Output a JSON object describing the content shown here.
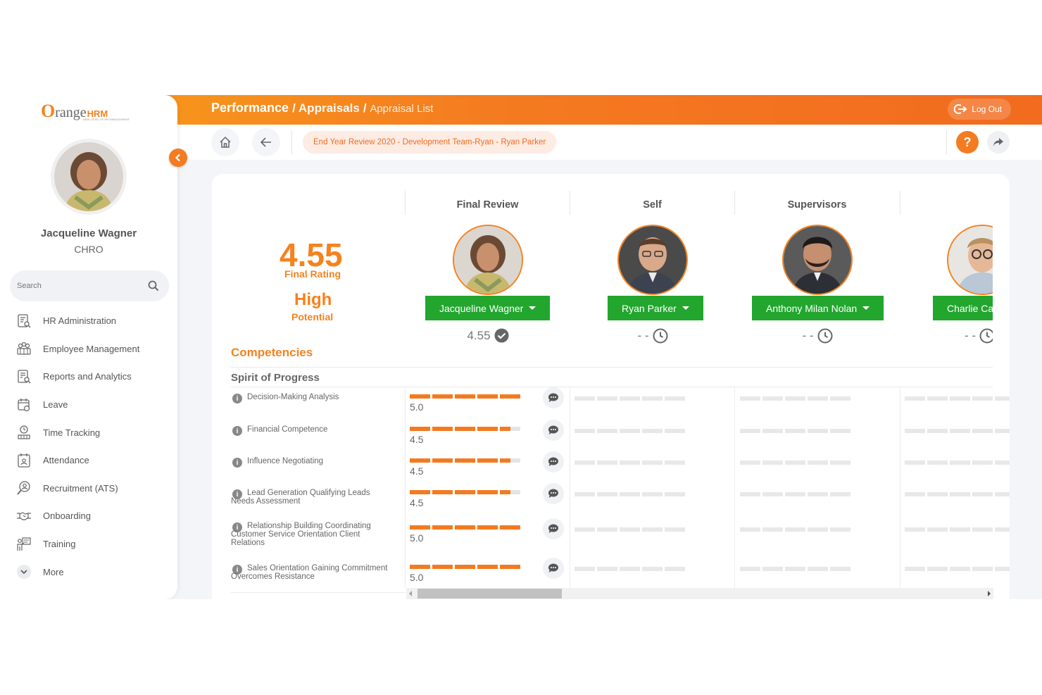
{
  "brand": {
    "logo_o": "O",
    "logo_range": "range",
    "logo_hrm": "HRM",
    "logo_tagline": "NEW LEVEL OF HR MANAGEMENT",
    "accent": "#f5821f",
    "green": "#22a62e"
  },
  "user": {
    "name": "Jacqueline Wagner",
    "role": "CHRO"
  },
  "search": {
    "placeholder": "Search"
  },
  "menu": [
    {
      "label": "HR Administration",
      "icon": "hr-admin-icon"
    },
    {
      "label": "Employee Management",
      "icon": "employee-management-icon"
    },
    {
      "label": "Reports and Analytics",
      "icon": "reports-icon"
    },
    {
      "label": "Leave",
      "icon": "leave-icon"
    },
    {
      "label": "Time Tracking",
      "icon": "time-tracking-icon"
    },
    {
      "label": "Attendance",
      "icon": "attendance-icon"
    },
    {
      "label": "Recruitment (ATS)",
      "icon": "recruitment-icon"
    },
    {
      "label": "Onboarding",
      "icon": "onboarding-icon"
    },
    {
      "label": "Training",
      "icon": "training-icon"
    },
    {
      "label": "More",
      "icon": "chevron-down-icon"
    }
  ],
  "header": {
    "crumb1": "Performance",
    "crumb2": "Appraisals",
    "crumb3": "Appraisal List",
    "logout": "Log Out"
  },
  "subheader": {
    "review_title": "End Year Review 2020 - Development Team-Ryan - Ryan Parker",
    "help": "?"
  },
  "summary": {
    "final_rating": "4.55",
    "final_rating_label": "Final Rating",
    "potential": "High",
    "potential_label": "Potential"
  },
  "columns": {
    "final_review": "Final Review",
    "self": "Self",
    "supervisors": "Supervisors"
  },
  "people": [
    {
      "name": "Jacqueline Wagner",
      "score": "4.55",
      "status": "completed-check-icon"
    },
    {
      "name": "Ryan Parker",
      "score": "- -",
      "status": "pending-clock-icon"
    },
    {
      "name": "Anthony Milan Nolan",
      "score": "- -",
      "status": "pending-clock-icon"
    },
    {
      "name": "Charlie Ca",
      "score": "- -",
      "status": "pending-clock-icon"
    }
  ],
  "competencies": {
    "title": "Competencies",
    "group": "Spirit of Progress",
    "items": [
      {
        "label": "Decision-Making Analysis",
        "value": "5.0",
        "rating": 5.0
      },
      {
        "label": "Financial Competence",
        "value": "4.5",
        "rating": 4.5
      },
      {
        "label": "Influence Negotiating",
        "value": "4.5",
        "rating": 4.5
      },
      {
        "label": "Lead Generation Qualifying Leads Needs Assessment",
        "value": "4.5",
        "rating": 4.5
      },
      {
        "label": "Relationship Building Coordinating Customer Service Orientation Client Relations",
        "value": "5.0",
        "rating": 5.0
      },
      {
        "label": "Sales Orientation Gaining Commitment Overcomes Resistance",
        "value": "5.0",
        "rating": 5.0
      }
    ]
  }
}
